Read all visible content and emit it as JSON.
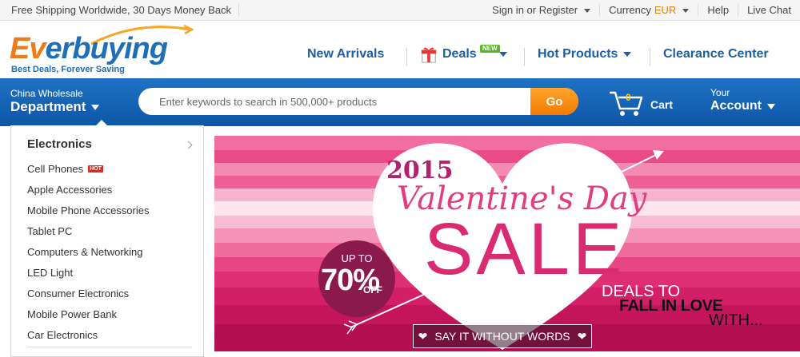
{
  "topbar": {
    "promo": "Free Shipping Worldwide, 30 Days Money Back",
    "signin": "Sign in or Register",
    "currency_label": "Currency",
    "currency_value": "EUR",
    "help": "Help",
    "live_chat": "Live Chat"
  },
  "logo": {
    "name_part1": "Ev",
    "name_part2": "erbuying",
    "tagline": "Best Deals, Forever Saving"
  },
  "nav": {
    "new_arrivals": "New Arrivals",
    "deals": "Deals",
    "deals_badge": "NEW",
    "hot_products": "Hot Products",
    "clearance": "Clearance Center"
  },
  "searchbar": {
    "dept_small": "China Wholesale",
    "dept_big": "Department",
    "placeholder": "Enter keywords to search in 500,000+ products",
    "go": "Go",
    "cart_count": "0",
    "cart_label": "Cart",
    "account_small": "Your",
    "account_big": "Account"
  },
  "categories": {
    "heading": "Electronics",
    "items": [
      {
        "label": "Cell Phones",
        "badge": "HOT"
      },
      {
        "label": "Apple Accessories"
      },
      {
        "label": "Mobile Phone Accessories"
      },
      {
        "label": "Tablet PC"
      },
      {
        "label": "Computers & Networking"
      },
      {
        "label": "LED Light"
      },
      {
        "label": "Consumer Electronics"
      },
      {
        "label": "Mobile Power Bank"
      },
      {
        "label": "Car Electronics"
      }
    ]
  },
  "banner": {
    "year": "2015",
    "title": "Valentine's Day",
    "sale": "SALE",
    "up_to": "UP TO",
    "percent": "70%",
    "off": "OFF",
    "deals_to": "DEALS TO",
    "fall_in_love": "FALL IN LOVE",
    "with": "WITH...",
    "cta": "SAY IT WITHOUT WORDS"
  },
  "colors": {
    "brand_blue": "#1b5fa4",
    "brand_orange": "#f07b16",
    "banner_pink": "#d92a72"
  }
}
